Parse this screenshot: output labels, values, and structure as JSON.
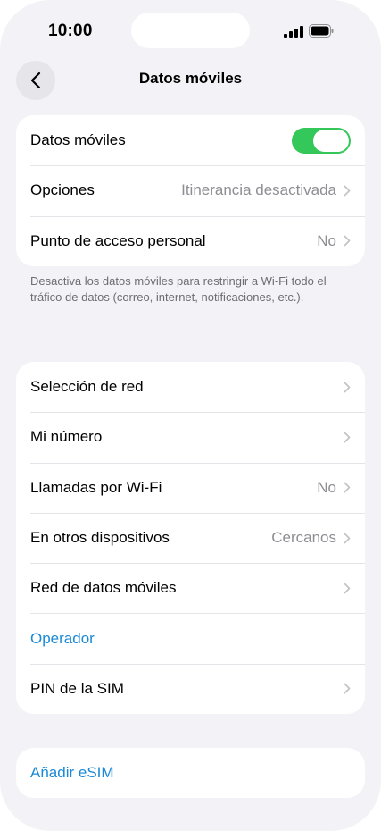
{
  "status_bar": {
    "time": "10:00"
  },
  "nav": {
    "title": "Datos móviles"
  },
  "group1": {
    "rows": [
      {
        "label": "Datos móviles",
        "toggle_on": true
      },
      {
        "label": "Opciones",
        "value": "Itinerancia desactivada"
      },
      {
        "label": "Punto de acceso personal",
        "value": "No"
      }
    ],
    "footer": "Desactiva los datos móviles para restringir a Wi-Fi todo el tráfico de datos (correo, internet, notificaciones, etc.)."
  },
  "group2": {
    "rows": [
      {
        "label": "Selección de red"
      },
      {
        "label": "Mi número"
      },
      {
        "label": "Llamadas por Wi-Fi",
        "value": "No"
      },
      {
        "label": "En otros dispositivos",
        "value": "Cercanos"
      },
      {
        "label": "Red de datos móviles"
      },
      {
        "label": "Operador"
      },
      {
        "label": "PIN de la SIM"
      }
    ]
  },
  "group3": {
    "rows": [
      {
        "label": "Añadir eSIM"
      }
    ]
  },
  "colors": {
    "accent": "#1a8ad6",
    "toggle_on": "#34c759",
    "background": "#f2f2f7"
  }
}
